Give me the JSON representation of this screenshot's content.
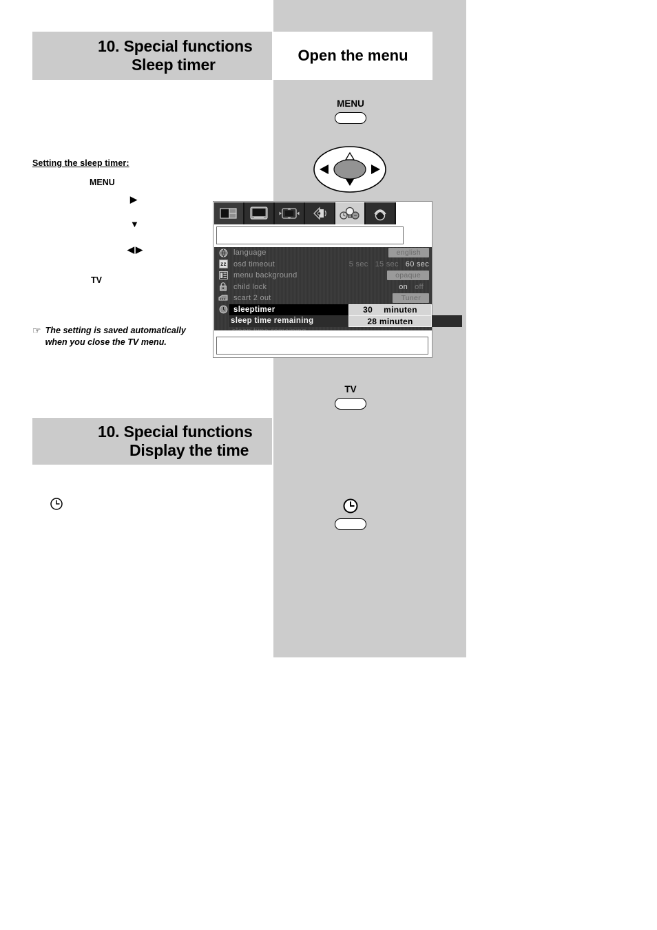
{
  "sections": [
    {
      "number_title": "10. Special functions",
      "subtitle": "Sleep timer"
    },
    {
      "number_title": "10. Special functions",
      "subtitle": "Display the time"
    }
  ],
  "banner": {
    "title": "Open the menu"
  },
  "instructions": {
    "heading": "Setting the sleep timer:",
    "steps": [
      {
        "label": "MENU"
      },
      {
        "label": "▶"
      },
      {
        "label": "▼"
      },
      {
        "label": "◀▶"
      },
      {
        "label": "TV"
      }
    ],
    "note": {
      "icon": "pointing-hand-icon",
      "text": "The setting is saved automatically when you close the TV menu."
    },
    "clock_icon": "clock-icon"
  },
  "remote": {
    "menu_button": {
      "label": "MENU",
      "icon": ""
    },
    "nav_pad": {
      "up": "△",
      "down": "▼",
      "left": "◀",
      "right": "▶"
    },
    "tv_button": {
      "label": "TV"
    },
    "clock_button": {
      "label": "",
      "icon": "clock-icon"
    }
  },
  "osd": {
    "tabs": [
      {
        "icon": "picture-in-picture-icon",
        "active": false
      },
      {
        "icon": "tv-screen-icon",
        "active": false
      },
      {
        "icon": "picture-format-icon",
        "active": false
      },
      {
        "icon": "sound-icon",
        "active": false
      },
      {
        "icon": "special-functions-icon",
        "active": true
      },
      {
        "icon": "installation-icon",
        "active": false
      }
    ],
    "rows": [
      {
        "icon": "globe-icon",
        "name": "language",
        "values": [
          {
            "text": "english",
            "style": "pill"
          }
        ]
      },
      {
        "icon": "zz-timer-icon",
        "name": "osd timeout",
        "values": [
          {
            "text": "5 sec",
            "style": "dim"
          },
          {
            "text": "15 sec",
            "style": "dim"
          },
          {
            "text": "60 sec",
            "style": "lit"
          }
        ]
      },
      {
        "icon": "menu-background-icon",
        "name": "menu background",
        "values": [
          {
            "text": "opaque",
            "style": "pill"
          }
        ]
      },
      {
        "icon": "child-lock-icon",
        "name": "child lock",
        "values": [
          {
            "text": "on",
            "style": "lit"
          },
          {
            "text": "off",
            "style": "dim"
          }
        ]
      },
      {
        "icon": "scart-icon",
        "name": "scart 2 out",
        "values": [
          {
            "text": "Tuner",
            "style": "pill"
          }
        ]
      }
    ],
    "selected_row": {
      "icon": "sleeptimer-clock-icon",
      "name": "sleeptimer",
      "value_number": "30",
      "value_unit": "minuten"
    },
    "sub_row": {
      "name": "sleep time remaining",
      "value": "28 minuten"
    },
    "ghost_row": {
      "name": "sleep time remaining"
    }
  },
  "colors": {
    "page_background": "#ffffff",
    "grey_column": "#cccccc",
    "heading_block": "#cbcbcb",
    "osd_dark": "#3a3a3a",
    "osd_highlight": "#000000",
    "osd_value_box": "#d5d5d5"
  }
}
